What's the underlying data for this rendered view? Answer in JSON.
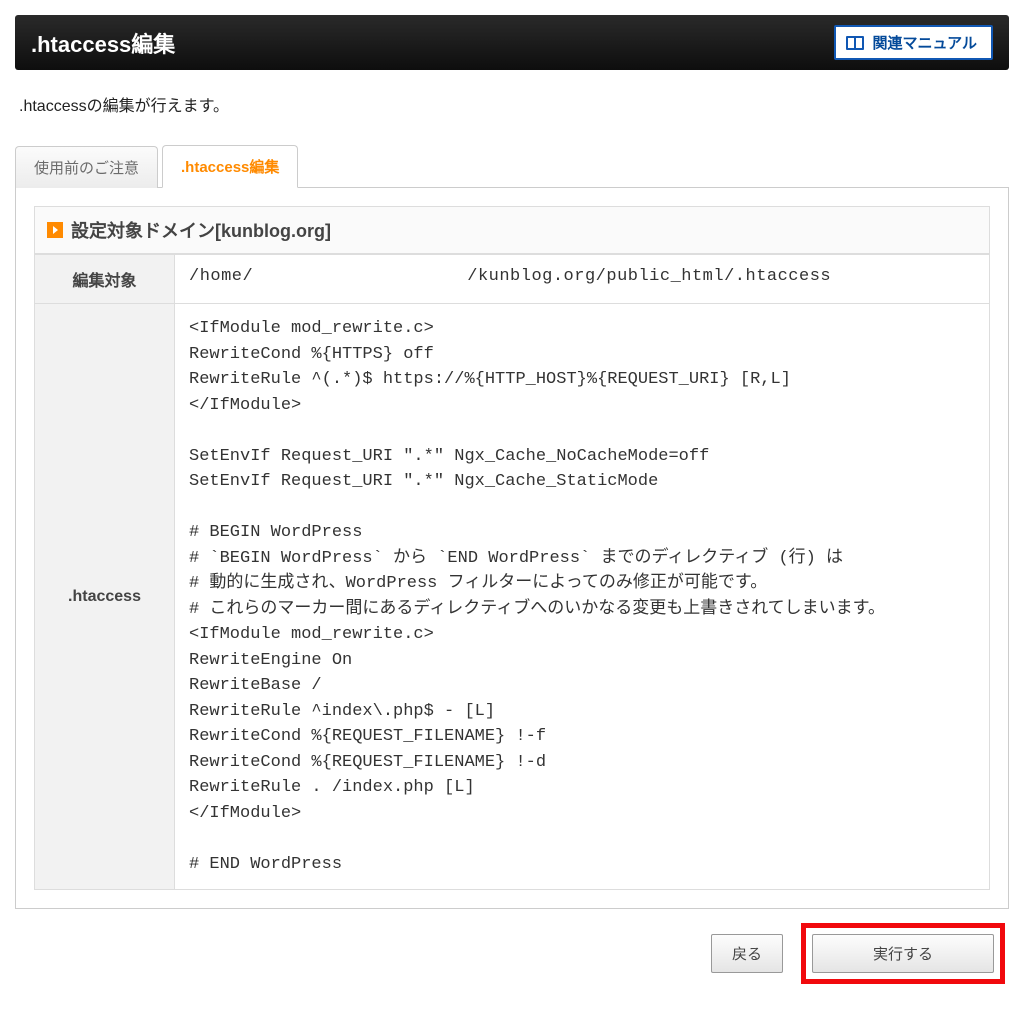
{
  "header": {
    "title": ".htaccess編集",
    "manual_link_label": "関連マニュアル"
  },
  "intro_text": ".htaccessの編集が行えます。",
  "tabs": {
    "precautions_label": "使用前のご注意",
    "edit_label": ".htaccess編集"
  },
  "section_title": "設定対象ドメイン[kunblog.org]",
  "table": {
    "row1_label": "編集対象",
    "row1_value": "/home/                    /kunblog.org/public_html/.htaccess",
    "row2_label": ".htaccess",
    "row2_value": "<IfModule mod_rewrite.c>\nRewriteCond %{HTTPS} off\nRewriteRule ^(.*)$ https://%{HTTP_HOST}%{REQUEST_URI} [R,L]\n</IfModule>\n\nSetEnvIf Request_URI \".*\" Ngx_Cache_NoCacheMode=off\nSetEnvIf Request_URI \".*\" Ngx_Cache_StaticMode\n\n# BEGIN WordPress\n# `BEGIN WordPress` から `END WordPress` までのディレクティブ (行) は\n# 動的に生成され、WordPress フィルターによってのみ修正が可能です。\n# これらのマーカー間にあるディレクティブへのいかなる変更も上書きされてしまいます。\n<IfModule mod_rewrite.c>\nRewriteEngine On\nRewriteBase /\nRewriteRule ^index\\.php$ - [L]\nRewriteCond %{REQUEST_FILENAME} !-f\nRewriteCond %{REQUEST_FILENAME} !-d\nRewriteRule . /index.php [L]\n</IfModule>\n\n# END WordPress"
  },
  "buttons": {
    "back_label": "戻る",
    "execute_label": "実行する"
  }
}
